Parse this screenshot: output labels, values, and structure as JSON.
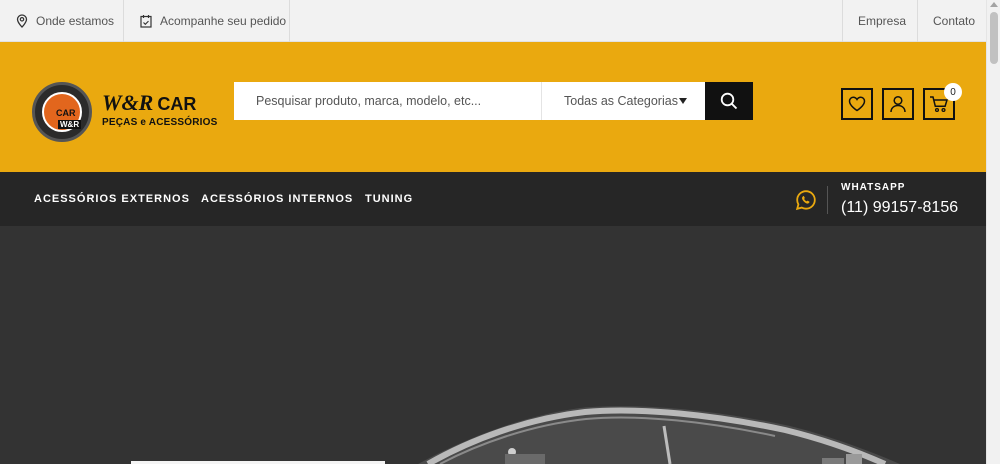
{
  "topbar": {
    "location_label": "Onde estamos",
    "orders_label": "Acompanhe seu pedido",
    "company_label": "Empresa",
    "contact_label": "Contato"
  },
  "logo": {
    "badge_top": "CAR",
    "badge_mid": "W&R",
    "brand": "W&R",
    "brand_car": "CAR",
    "tagline": "PEÇAS e ACESSÓRIOS"
  },
  "search": {
    "placeholder": "Pesquisar produto, marca, modelo, etc...",
    "category_selected": "Todas as Categorias"
  },
  "cart": {
    "count": "0"
  },
  "nav": {
    "items": [
      {
        "label": "ACESSÓRIOS EXTERNOS"
      },
      {
        "label": "ACESSÓRIOS INTERNOS"
      },
      {
        "label": "TUNING"
      }
    ]
  },
  "whatsapp": {
    "label": "WHATSAPP",
    "phone": "(11) 99157-8156"
  },
  "colors": {
    "header_bg": "#eaa90f",
    "nav_bg": "#262626",
    "hero_bg": "#333333",
    "accent": "#eaa90f"
  },
  "icons": {
    "location": "map-pin-icon",
    "orders": "calendar-icon",
    "search": "search-icon",
    "wishlist": "heart-icon",
    "account": "user-icon",
    "cart": "cart-icon",
    "whatsapp": "whatsapp-icon"
  }
}
